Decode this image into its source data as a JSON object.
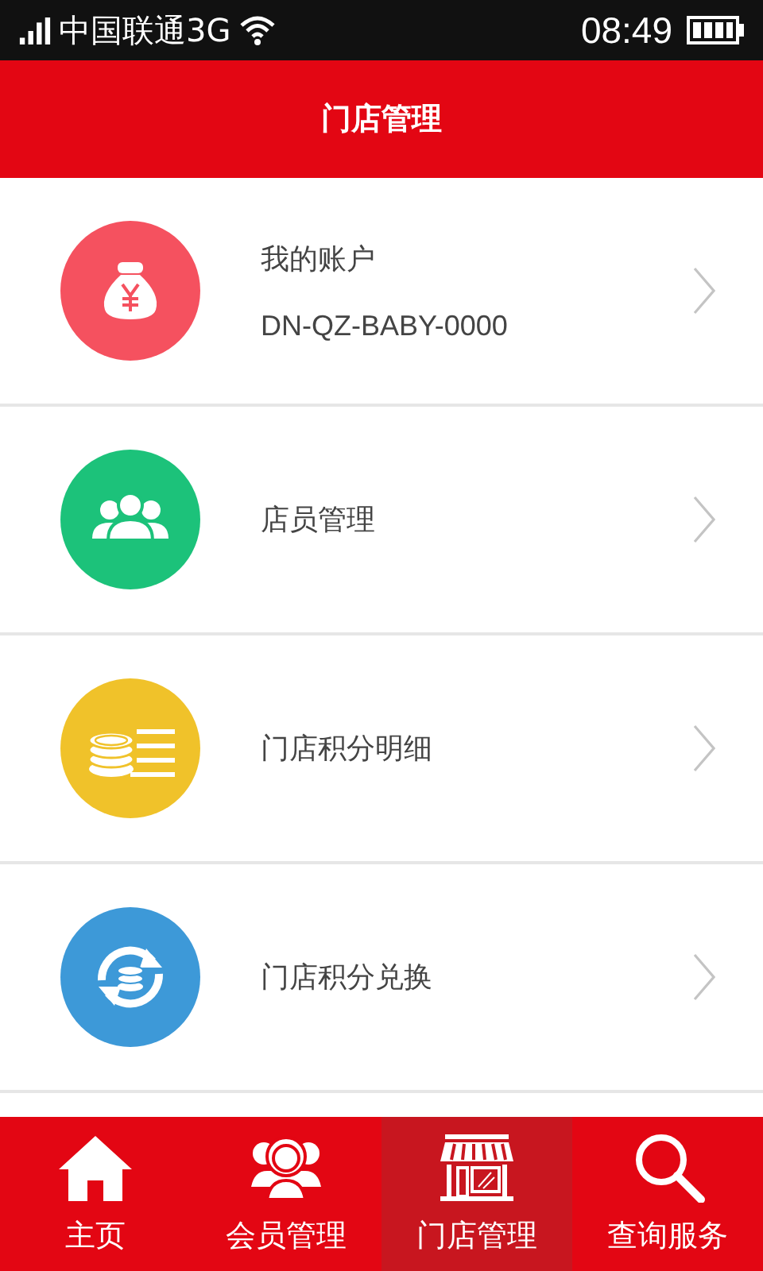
{
  "status_bar": {
    "carrier": "中国联通3G",
    "time": "08:49"
  },
  "header": {
    "title": "门店管理"
  },
  "menu_items": [
    {
      "kind": "money-bag",
      "color": "#f5515f",
      "label": "我的账户",
      "subtitle": "DN-QZ-BABY-0000"
    },
    {
      "kind": "people",
      "color": "#1cc27a",
      "label": "店员管理"
    },
    {
      "kind": "coins",
      "color": "#f0c22a",
      "label": "门店积分明细"
    },
    {
      "kind": "exchange",
      "color": "#3d99d8",
      "label": "门店积分兑换"
    }
  ],
  "tab_bar": [
    {
      "kind": "home",
      "label": "主页",
      "selected": false
    },
    {
      "kind": "members",
      "label": "会员管理",
      "selected": false
    },
    {
      "kind": "store",
      "label": "门店管理",
      "selected": true
    },
    {
      "kind": "search",
      "label": "查询服务",
      "selected": false
    }
  ]
}
